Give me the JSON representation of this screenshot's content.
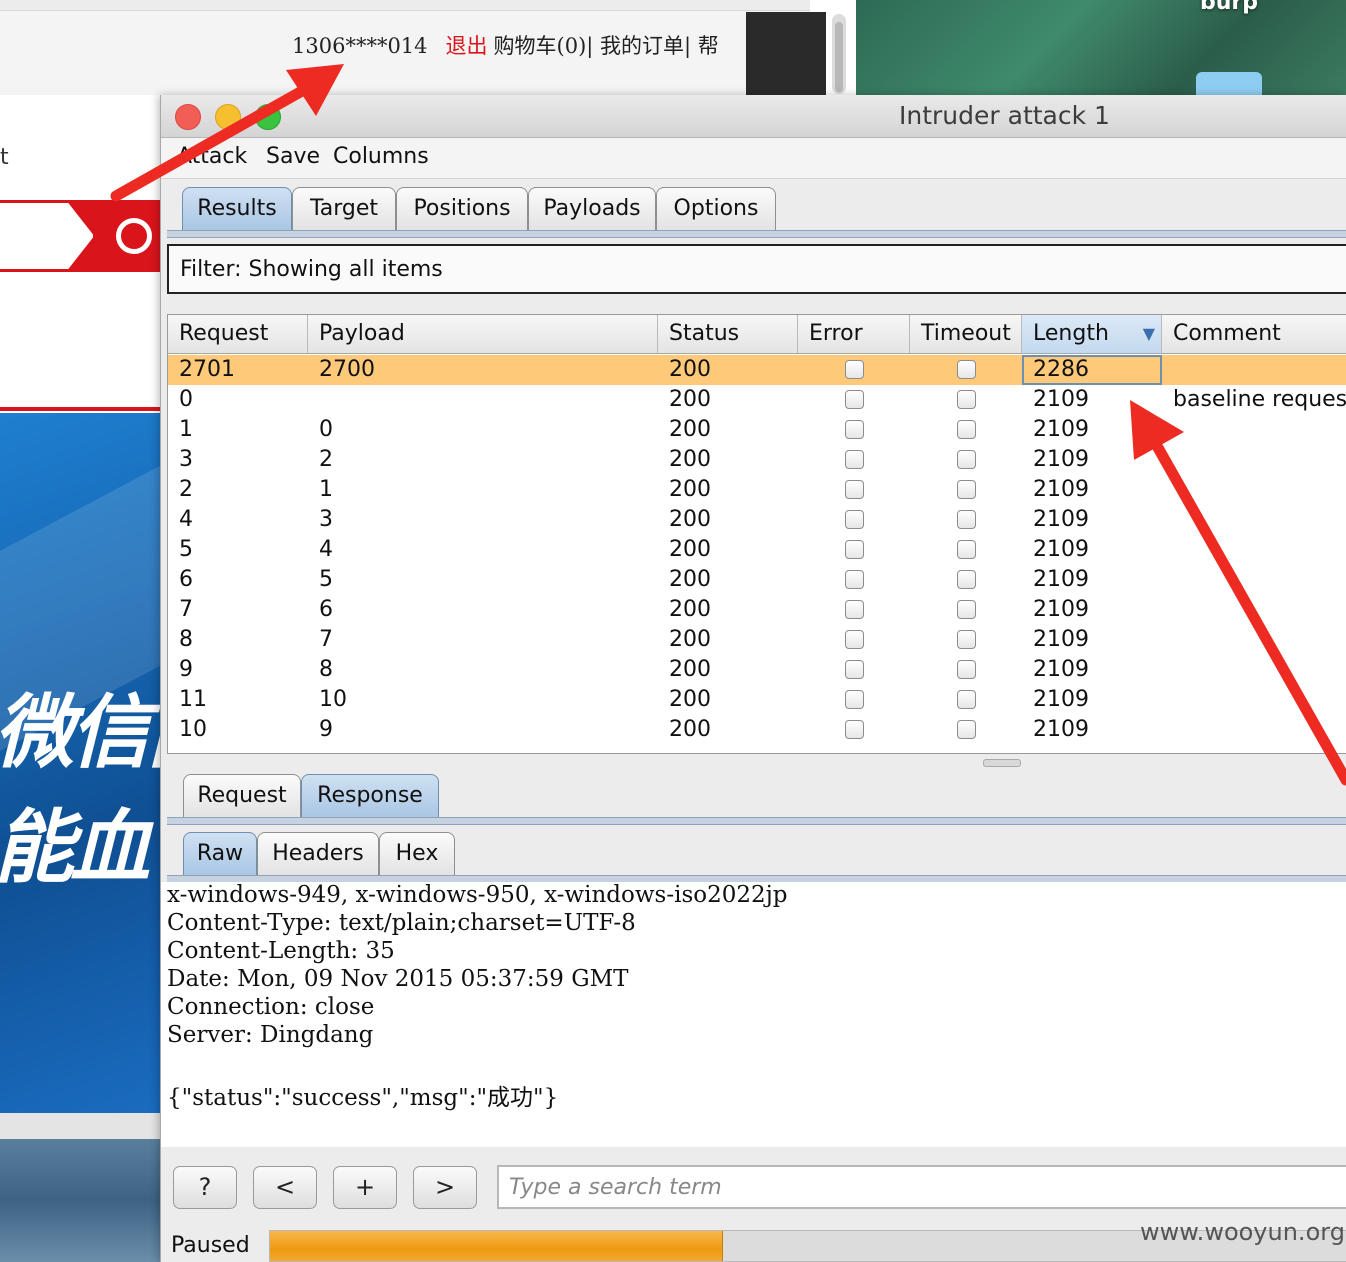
{
  "background_page": {
    "user_phone": "1306****014",
    "logout": "退出",
    "top_links": "购物车(0)| 我的订单| 帮",
    "left_glyph": "t",
    "banner_line1": "微信由",
    "banner_line2": "能血"
  },
  "desktop": {
    "folder_label": "burp"
  },
  "window": {
    "title": "Intruder attack 1",
    "menu": [
      "Attack",
      "Save",
      "Columns"
    ],
    "tabs": [
      "Results",
      "Target",
      "Positions",
      "Payloads",
      "Options"
    ],
    "active_tab": "Results"
  },
  "filter": {
    "text": "Filter: Showing all items"
  },
  "table": {
    "columns": [
      "Request",
      "Payload",
      "Status",
      "Error",
      "Timeout",
      "Length",
      "Comment"
    ],
    "sorted_column": "Length",
    "rows": [
      {
        "request": "2701",
        "payload": "2700",
        "status": "200",
        "error": false,
        "timeout": false,
        "length": "2286",
        "comment": "",
        "selected": true
      },
      {
        "request": "0",
        "payload": "",
        "status": "200",
        "error": false,
        "timeout": false,
        "length": "2109",
        "comment": "baseline request"
      },
      {
        "request": "1",
        "payload": "0",
        "status": "200",
        "error": false,
        "timeout": false,
        "length": "2109",
        "comment": ""
      },
      {
        "request": "3",
        "payload": "2",
        "status": "200",
        "error": false,
        "timeout": false,
        "length": "2109",
        "comment": ""
      },
      {
        "request": "2",
        "payload": "1",
        "status": "200",
        "error": false,
        "timeout": false,
        "length": "2109",
        "comment": ""
      },
      {
        "request": "4",
        "payload": "3",
        "status": "200",
        "error": false,
        "timeout": false,
        "length": "2109",
        "comment": ""
      },
      {
        "request": "5",
        "payload": "4",
        "status": "200",
        "error": false,
        "timeout": false,
        "length": "2109",
        "comment": ""
      },
      {
        "request": "6",
        "payload": "5",
        "status": "200",
        "error": false,
        "timeout": false,
        "length": "2109",
        "comment": ""
      },
      {
        "request": "7",
        "payload": "6",
        "status": "200",
        "error": false,
        "timeout": false,
        "length": "2109",
        "comment": ""
      },
      {
        "request": "8",
        "payload": "7",
        "status": "200",
        "error": false,
        "timeout": false,
        "length": "2109",
        "comment": ""
      },
      {
        "request": "9",
        "payload": "8",
        "status": "200",
        "error": false,
        "timeout": false,
        "length": "2109",
        "comment": ""
      },
      {
        "request": "11",
        "payload": "10",
        "status": "200",
        "error": false,
        "timeout": false,
        "length": "2109",
        "comment": ""
      },
      {
        "request": "10",
        "payload": "9",
        "status": "200",
        "error": false,
        "timeout": false,
        "length": "2109",
        "comment": ""
      }
    ]
  },
  "detail_tabs": {
    "items": [
      "Request",
      "Response"
    ],
    "active": "Response"
  },
  "view_tabs": {
    "items": [
      "Raw",
      "Headers",
      "Hex"
    ],
    "active": "Raw"
  },
  "response_lines": [
    "x-windows-949, x-windows-950, x-windows-iso2022jp",
    "Content-Type: text/plain;charset=UTF-8",
    "Content-Length: 35",
    "Date: Mon, 09 Nov 2015 05:37:59 GMT",
    "Connection: close",
    "Server: Dingdang",
    "",
    "{\"status\":\"success\",\"msg\":\"成功\"}"
  ],
  "nav_buttons": [
    "?",
    "<",
    "+",
    ">"
  ],
  "search": {
    "placeholder": "Type a search term",
    "value": ""
  },
  "status": {
    "label": "Paused",
    "progress_fraction": 0.42
  },
  "watermark": "www.wooyun.org",
  "colors": {
    "selected_row": "#ffc97a",
    "annotation_arrow": "#ee2b22",
    "progress": "#ef9a12"
  }
}
